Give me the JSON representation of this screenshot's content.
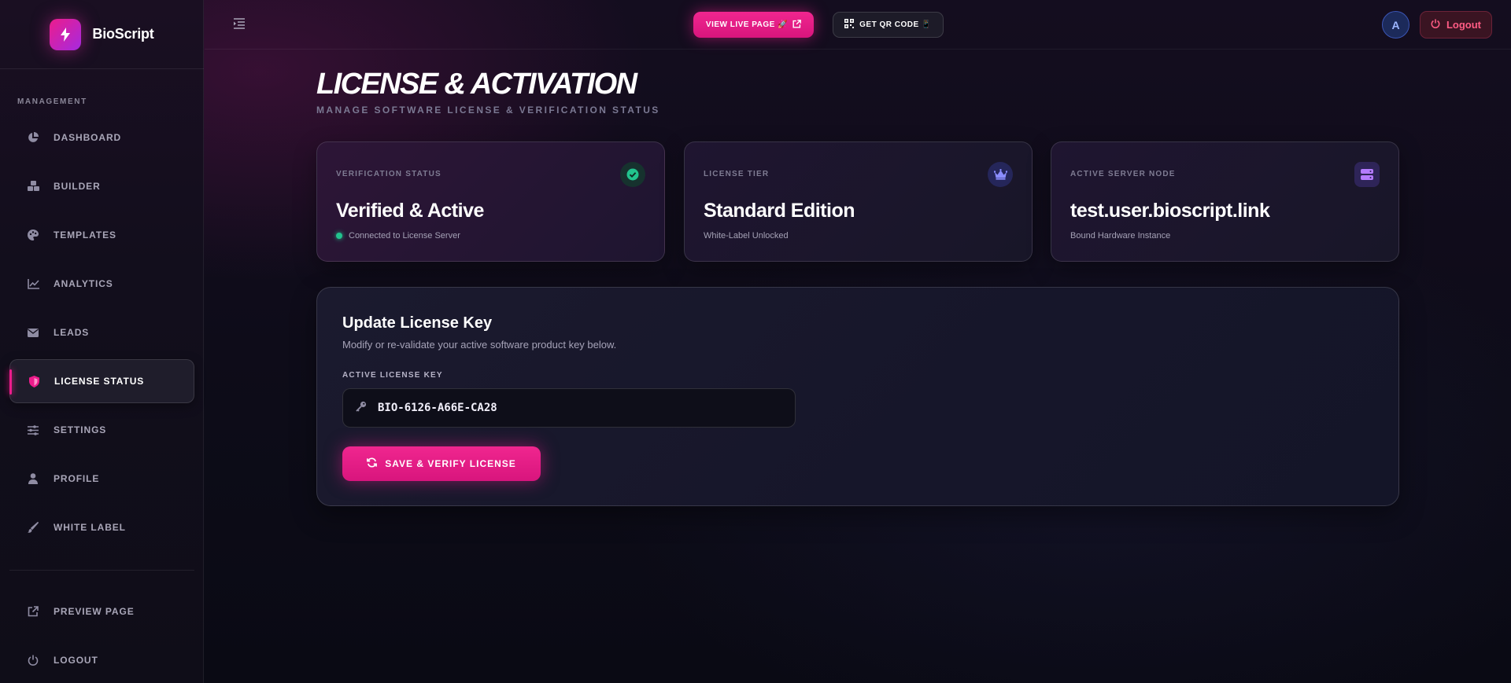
{
  "brand": {
    "name": "BioScript"
  },
  "sidebar": {
    "section_label": "MANAGEMENT",
    "items": [
      {
        "label": "DASHBOARD",
        "icon": "pie-chart-icon"
      },
      {
        "label": "BUILDER",
        "icon": "cubes-icon"
      },
      {
        "label": "TEMPLATES",
        "icon": "palette-icon"
      },
      {
        "label": "ANALYTICS",
        "icon": "line-chart-icon"
      },
      {
        "label": "LEADS",
        "icon": "envelope-icon"
      },
      {
        "label": "LICENSE STATUS",
        "icon": "shield-icon",
        "active": true
      },
      {
        "label": "SETTINGS",
        "icon": "sliders-icon"
      },
      {
        "label": "PROFILE",
        "icon": "user-icon"
      },
      {
        "label": "WHITE LABEL",
        "icon": "brush-icon"
      }
    ],
    "footer_items": [
      {
        "label": "PREVIEW PAGE",
        "icon": "external-link-icon"
      },
      {
        "label": "LOGOUT",
        "icon": "power-icon"
      }
    ]
  },
  "topbar": {
    "view_live_label": "VIEW LIVE PAGE 🚀",
    "qr_label": "GET QR CODE 📱",
    "avatar_initial": "A",
    "logout_label": "Logout"
  },
  "page": {
    "title": "LICENSE & ACTIVATION",
    "subtitle": "MANAGE SOFTWARE LICENSE & VERIFICATION STATUS"
  },
  "cards": [
    {
      "label": "VERIFICATION STATUS",
      "value": "Verified & Active",
      "note": "Connected to License Server",
      "icon": "check-circle-icon"
    },
    {
      "label": "LICENSE TIER",
      "value": "Standard Edition",
      "note": "White-Label Unlocked",
      "icon": "crown-icon"
    },
    {
      "label": "ACTIVE SERVER NODE",
      "value": "test.user.bioscript.link",
      "note": "Bound Hardware Instance",
      "icon": "server-icon"
    }
  ],
  "license_panel": {
    "title": "Update License Key",
    "description": "Modify or re-validate your active software product key below.",
    "field_label": "ACTIVE LICENSE KEY",
    "key_value": "BIO-6126-A66E-CA28",
    "save_label": "SAVE & VERIFY LICENSE"
  },
  "colors": {
    "accent": "#ec1c8c",
    "success": "#22c38e",
    "danger": "#ff5c84",
    "background": "#0c0b17"
  }
}
